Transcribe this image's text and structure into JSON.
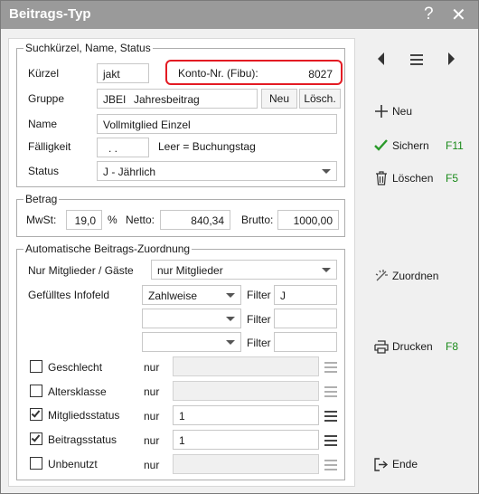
{
  "window": {
    "title": "Beitrags-Typ",
    "help_glyph": "?",
    "close_glyph": "✕"
  },
  "search_group": {
    "legend": "Suchkürzel, Name, Status",
    "kuerzel_label": "Kürzel",
    "kuerzel_value": "jakt",
    "konto_label": "Konto-Nr. (Fibu):",
    "konto_value": "8027",
    "gruppe_label": "Gruppe",
    "gruppe_code": "JBEI",
    "gruppe_name": "Jahresbeitrag",
    "neu_btn": "Neu",
    "loesch_btn": "Lösch.",
    "name_label": "Name",
    "name_value": "Vollmitglied Einzel",
    "faellig_label": "Fälligkeit",
    "faellig_value": ". .",
    "faellig_hint": "Leer = Buchungstag",
    "status_label": "Status",
    "status_value": "J - Jährlich"
  },
  "amount_group": {
    "legend": "Betrag",
    "mwst_label": "MwSt:",
    "mwst_value": "19,0",
    "percent": "%",
    "netto_label": "Netto:",
    "netto_value": "840,34",
    "brutto_label": "Brutto:",
    "brutto_value": "1000,00"
  },
  "auto_group": {
    "legend": "Automatische Beitrags-Zuordnung",
    "mitglieder_label": "Nur Mitglieder / Gäste",
    "mitglieder_value": "nur Mitglieder",
    "infofeld_label": "Gefülltes Infofeld",
    "filter_label": "Filter",
    "infofeld_rows": [
      {
        "select": "Zahlweise",
        "filter": "J"
      },
      {
        "select": "",
        "filter": ""
      },
      {
        "select": "",
        "filter": ""
      }
    ],
    "nur_label": "nur",
    "checks": [
      {
        "label": "Geschlecht",
        "checked": false,
        "value": ""
      },
      {
        "label": "Altersklasse",
        "checked": false,
        "value": ""
      },
      {
        "label": "Mitgliedsstatus",
        "checked": true,
        "value": "1"
      },
      {
        "label": "Beitragsstatus",
        "checked": true,
        "value": "1"
      },
      {
        "label": "Unbenutzt",
        "checked": false,
        "value": ""
      }
    ]
  },
  "sidebar": {
    "neu": "Neu",
    "sichern": "Sichern",
    "sichern_key": "F11",
    "loeschen": "Löschen",
    "loeschen_key": "F5",
    "zuordnen": "Zuordnen",
    "drucken": "Drucken",
    "drucken_key": "F8",
    "ende": "Ende"
  },
  "colors": {
    "highlight": "#e31b23",
    "shortcut": "#1a8a1a",
    "title_bg": "#9a9a9a"
  }
}
